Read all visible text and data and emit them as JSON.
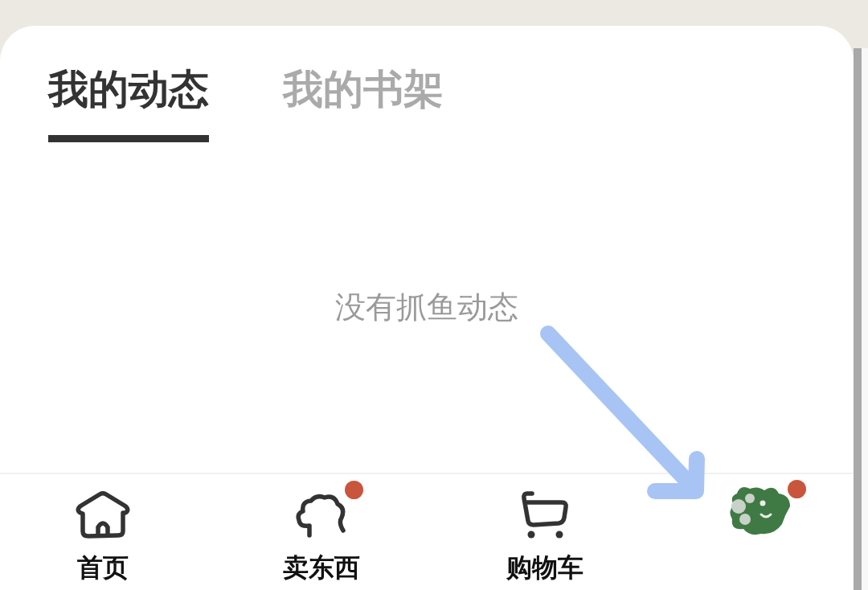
{
  "tabs": [
    {
      "label": "我的动态",
      "selected": true
    },
    {
      "label": "我的书架",
      "selected": false
    }
  ],
  "empty_message": "没有抓鱼动态",
  "bottom_nav": [
    {
      "kind": "home",
      "label": "首页",
      "badge": false
    },
    {
      "kind": "sell",
      "label": "卖东西",
      "badge": true
    },
    {
      "kind": "cart",
      "label": "购物车",
      "badge": false
    },
    {
      "kind": "avatar",
      "badge": true
    }
  ]
}
